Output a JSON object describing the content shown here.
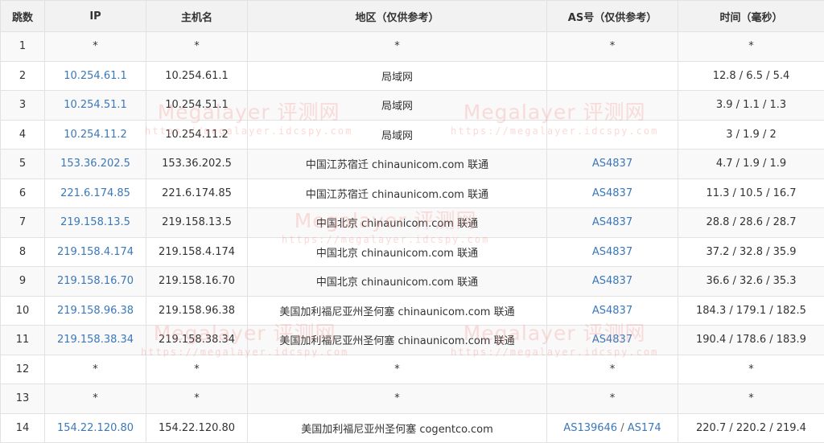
{
  "headers": {
    "hop": "跳数",
    "ip": "IP",
    "hostname": "主机名",
    "region": "地区（仅供参考）",
    "asn": "AS号（仅供参考）",
    "time": "时间（毫秒）"
  },
  "rows": [
    {
      "hop": "1",
      "ip": "*",
      "host": "*",
      "region": "*",
      "as": [
        "*"
      ],
      "time": "*"
    },
    {
      "hop": "2",
      "ip": "10.254.61.1",
      "host": "10.254.61.1",
      "region": "局域网",
      "as": [],
      "time": "12.8 / 6.5 / 5.4"
    },
    {
      "hop": "3",
      "ip": "10.254.51.1",
      "host": "10.254.51.1",
      "region": "局域网",
      "as": [],
      "time": "3.9 / 1.1 / 1.3"
    },
    {
      "hop": "4",
      "ip": "10.254.11.2",
      "host": "10.254.11.2",
      "region": "局域网",
      "as": [],
      "time": "3 / 1.9 / 2"
    },
    {
      "hop": "5",
      "ip": "153.36.202.5",
      "host": "153.36.202.5",
      "region": "中国江苏宿迁 chinaunicom.com 联通",
      "as": [
        "AS4837"
      ],
      "time": "4.7 / 1.9 / 1.9"
    },
    {
      "hop": "6",
      "ip": "221.6.174.85",
      "host": "221.6.174.85",
      "region": "中国江苏宿迁 chinaunicom.com 联通",
      "as": [
        "AS4837"
      ],
      "time": "11.3 / 10.5 / 16.7"
    },
    {
      "hop": "7",
      "ip": "219.158.13.5",
      "host": "219.158.13.5",
      "region": "中国北京 chinaunicom.com 联通",
      "as": [
        "AS4837"
      ],
      "time": "28.8 / 28.6 / 28.7"
    },
    {
      "hop": "8",
      "ip": "219.158.4.174",
      "host": "219.158.4.174",
      "region": "中国北京 chinaunicom.com 联通",
      "as": [
        "AS4837"
      ],
      "time": "37.2 / 32.8 / 35.9"
    },
    {
      "hop": "9",
      "ip": "219.158.16.70",
      "host": "219.158.16.70",
      "region": "中国北京 chinaunicom.com 联通",
      "as": [
        "AS4837"
      ],
      "time": "36.6 / 32.6 / 35.3"
    },
    {
      "hop": "10",
      "ip": "219.158.96.38",
      "host": "219.158.96.38",
      "region": "美国加利福尼亚州圣何塞 chinaunicom.com 联通",
      "as": [
        "AS4837"
      ],
      "time": "184.3 / 179.1 / 182.5"
    },
    {
      "hop": "11",
      "ip": "219.158.38.34",
      "host": "219.158.38.34",
      "region": "美国加利福尼亚州圣何塞 chinaunicom.com 联通",
      "as": [
        "AS4837"
      ],
      "time": "190.4 / 178.6 / 183.9"
    },
    {
      "hop": "12",
      "ip": "*",
      "host": "*",
      "region": "*",
      "as": [
        "*"
      ],
      "time": "*"
    },
    {
      "hop": "13",
      "ip": "*",
      "host": "*",
      "region": "*",
      "as": [
        "*"
      ],
      "time": "*"
    },
    {
      "hop": "14",
      "ip": "154.22.120.80",
      "host": "154.22.120.80",
      "region": "美国加利福尼亚州圣何塞 cogentco.com",
      "as": [
        "AS139646",
        "AS174"
      ],
      "time": "220.7 / 220.2 / 219.4"
    }
  ],
  "as_separator": " / ",
  "watermark": {
    "title": "Megalayer 评测网",
    "url": "https://megalayer.idcspy.com"
  },
  "colors": {
    "link": "#3b78b8",
    "header_bg": "#f2f2f2",
    "stripe_bg": "#f9f9f9",
    "border": "#e2e2e2",
    "watermark": "#f4918c"
  }
}
